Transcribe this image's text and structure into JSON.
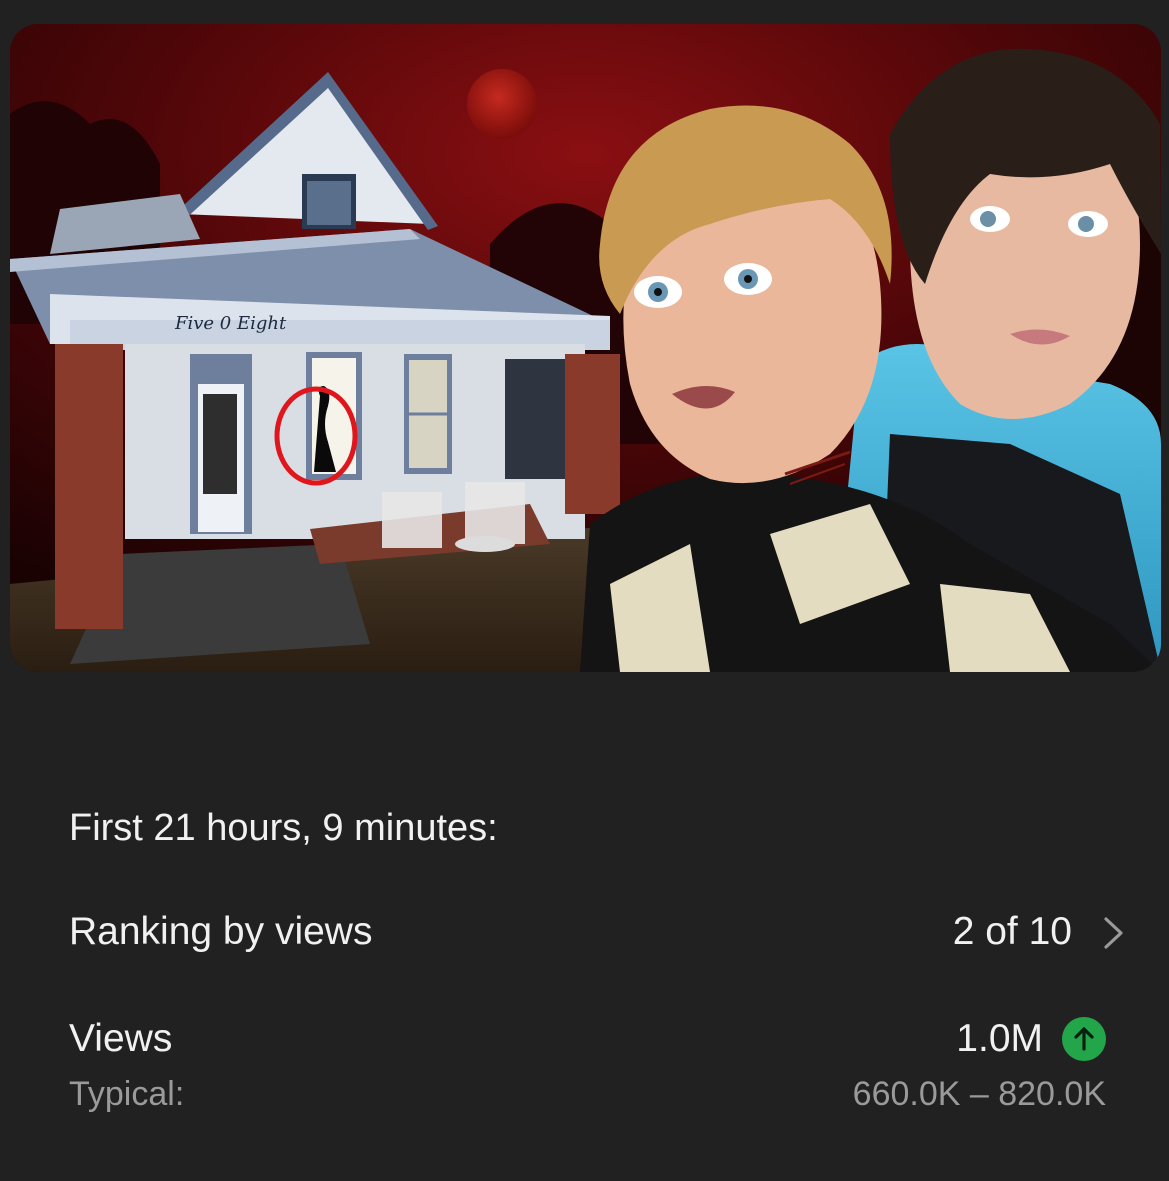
{
  "thumbnail": {
    "house_number_sign": "Five 0 Eight"
  },
  "stats": {
    "period_label": "First 21 hours, 9 minutes:",
    "ranking": {
      "label": "Ranking by views",
      "value": "2 of 10",
      "icon": "chevron-right-icon"
    },
    "views": {
      "label": "Views",
      "value": "1.0M",
      "trend_icon": "arrow-up-icon",
      "trend_color": "#23a64a",
      "typical_label": "Typical:",
      "typical_range": "660.0K – 820.0K"
    }
  },
  "colors": {
    "background": "#212121",
    "primary_text": "#f1f1f1",
    "secondary_text": "#9a9a9a",
    "accent_green": "#23a64a"
  }
}
